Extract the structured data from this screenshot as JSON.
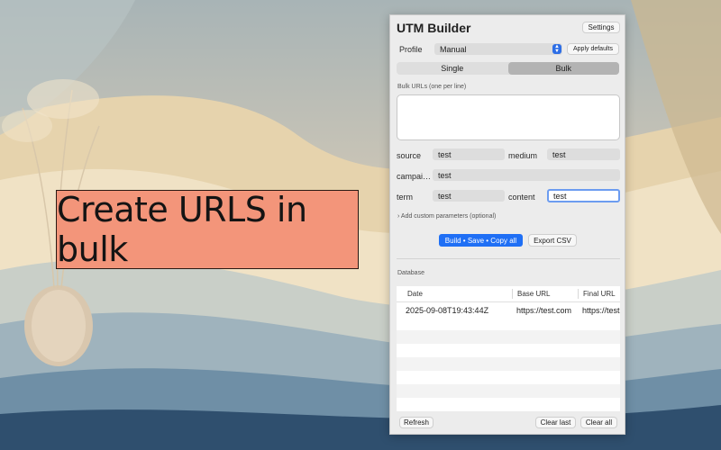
{
  "callout": {
    "text": "Create URLS in bulk"
  },
  "window": {
    "title": "UTM Builder",
    "settings_label": "Settings",
    "profile": {
      "label": "Profile",
      "selected": "Manual",
      "apply_label": "Apply defaults"
    },
    "mode_tabs": [
      {
        "label": "Single",
        "active": false
      },
      {
        "label": "Bulk",
        "active": true
      }
    ],
    "bulk_urls": {
      "label": "Bulk URLs (one per line)",
      "value": ""
    },
    "params": {
      "source": {
        "label": "source",
        "value": "test"
      },
      "medium": {
        "label": "medium",
        "value": "test"
      },
      "campaign": {
        "label": "campai…",
        "value": "test"
      },
      "term": {
        "label": "term",
        "value": "test"
      },
      "content": {
        "label": "content",
        "value": "test"
      }
    },
    "custom_params": {
      "chevron": "›",
      "label": "Add custom parameters (optional)"
    },
    "actions": {
      "build_label": "Build • Save • Copy all",
      "export_label": "Export CSV"
    },
    "database": {
      "label": "Database",
      "columns": [
        "Date",
        "Base URL",
        "Final URL"
      ],
      "rows": [
        {
          "date": "2025-09-08T19:43:44Z",
          "base_url": "https://test.com",
          "final_url": "https://test"
        }
      ]
    },
    "footer": {
      "refresh_label": "Refresh",
      "clear_last_label": "Clear last",
      "clear_all_label": "Clear all"
    },
    "accent_color": "#1f6ff5"
  }
}
